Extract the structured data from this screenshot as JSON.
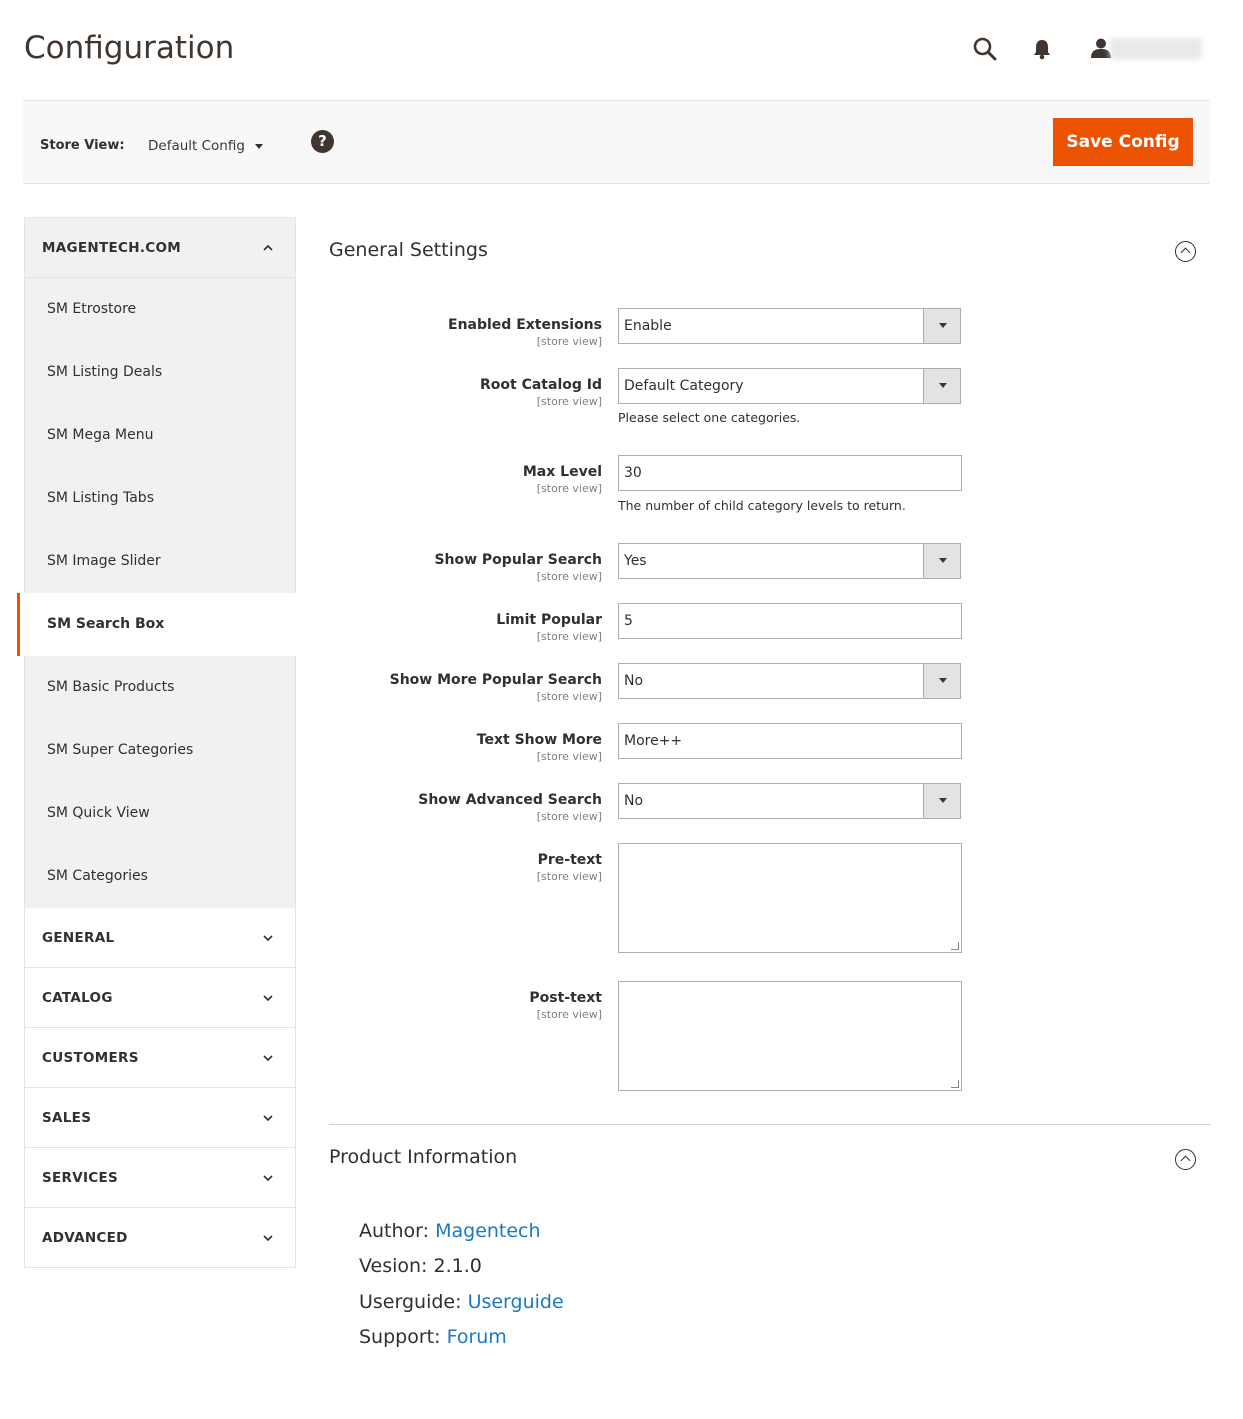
{
  "page": {
    "title": "Configuration"
  },
  "store": {
    "label": "Store View:",
    "value": "Default Config",
    "save_label": "Save Config"
  },
  "sidebar": {
    "open_section": "MAGENTECH.COM",
    "items": [
      "SM Etrostore",
      "SM Listing Deals",
      "SM Mega Menu",
      "SM Listing Tabs",
      "SM Image Slider",
      "SM Search Box",
      "SM Basic Products",
      "SM Super Categories",
      "SM Quick View",
      "SM Categories"
    ],
    "active_item": "SM Search Box",
    "sections": [
      "GENERAL",
      "CATALOG",
      "CUSTOMERS",
      "SALES",
      "SERVICES",
      "ADVANCED"
    ]
  },
  "general": {
    "title": "General Settings",
    "fields": {
      "enabled": {
        "label": "Enabled Extensions",
        "scope": "[store view]",
        "value": "Enable"
      },
      "root": {
        "label": "Root Catalog Id",
        "scope": "[store view]",
        "value": "Default Category",
        "note": "Please select one categories."
      },
      "maxlevel": {
        "label": "Max Level",
        "scope": "[store view]",
        "value": "30",
        "note": "The number of child category levels to return."
      },
      "popular": {
        "label": "Show Popular Search",
        "scope": "[store view]",
        "value": "Yes"
      },
      "limit": {
        "label": "Limit Popular",
        "scope": "[store view]",
        "value": "5"
      },
      "more": {
        "label": "Show More Popular Search",
        "scope": "[store view]",
        "value": "No"
      },
      "textmore": {
        "label": "Text Show More",
        "scope": "[store view]",
        "value": "More++"
      },
      "advanced": {
        "label": "Show Advanced Search",
        "scope": "[store view]",
        "value": "No"
      },
      "pretext": {
        "label": "Pre-text",
        "scope": "[store view]",
        "value": ""
      },
      "posttext": {
        "label": "Post-text",
        "scope": "[store view]",
        "value": ""
      }
    }
  },
  "product": {
    "title": "Product Information",
    "author_label": "Author:",
    "author_value": "Magentech",
    "version_text": "Vesion: 2.1.0",
    "userguide_label": "Userguide:",
    "userguide_value": "Userguide",
    "support_label": "Support:",
    "support_value": "Forum"
  },
  "colors": {
    "accent": "#eb5202",
    "link": "#1979c3",
    "text": "#303030"
  },
  "icons": [
    "search-icon",
    "bell-icon",
    "user-icon",
    "help-icon",
    "chevron-up-icon",
    "chevron-down-icon",
    "collapse-icon"
  ]
}
